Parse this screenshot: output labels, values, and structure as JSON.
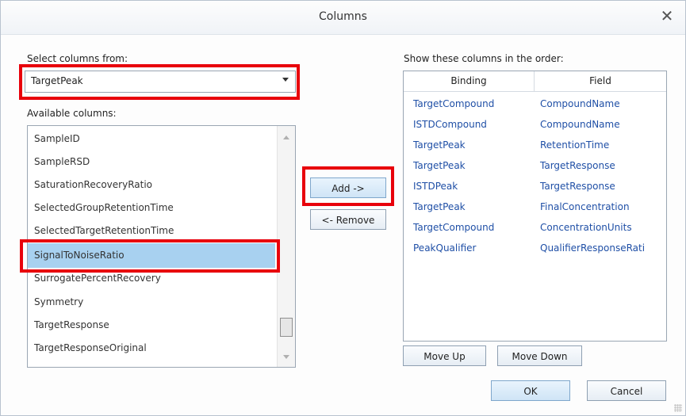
{
  "window": {
    "title": "Columns",
    "close_glyph": "✕"
  },
  "left": {
    "select_label": "Select columns from:",
    "select_value": "TargetPeak",
    "available_label": "Available columns:",
    "items": [
      "SampleID",
      "SampleRSD",
      "SaturationRecoveryRatio",
      "SelectedGroupRetentionTime",
      "SelectedTargetRetentionTime",
      "SignalToNoiseRatio",
      "SurrogatePercentRecovery",
      "Symmetry",
      "TargetResponse",
      "TargetResponseOriginal"
    ],
    "selected_item": "SignalToNoiseRatio"
  },
  "middle": {
    "add_label": "Add ->",
    "remove_label": "<- Remove"
  },
  "right": {
    "order_label": "Show these columns in the order:",
    "headers": {
      "binding": "Binding",
      "field": "Field"
    },
    "rows": [
      {
        "binding": "TargetCompound",
        "field": "CompoundName"
      },
      {
        "binding": "ISTDCompound",
        "field": "CompoundName"
      },
      {
        "binding": "TargetPeak",
        "field": "RetentionTime"
      },
      {
        "binding": "TargetPeak",
        "field": "TargetResponse"
      },
      {
        "binding": "ISTDPeak",
        "field": "TargetResponse"
      },
      {
        "binding": "TargetPeak",
        "field": "FinalConcentration"
      },
      {
        "binding": "TargetCompound",
        "field": "ConcentrationUnits"
      },
      {
        "binding": "PeakQualifier",
        "field": "QualifierResponseRati"
      }
    ],
    "move_up_label": "Move Up",
    "move_down_label": "Move Down"
  },
  "footer": {
    "ok_label": "OK",
    "cancel_label": "Cancel"
  },
  "colors": {
    "highlight_red": "#e8000b",
    "selection_blue": "#a8d1f0",
    "link_blue": "#1f4fa6"
  }
}
